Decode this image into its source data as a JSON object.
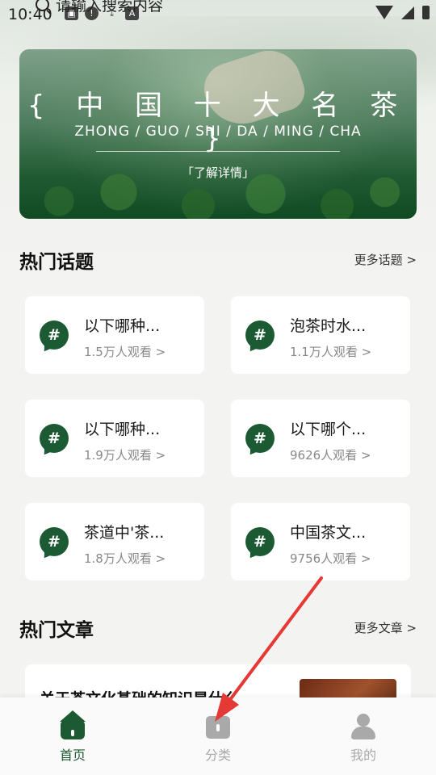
{
  "status_bar": {
    "time": "10:40",
    "icons": [
      "image-icon",
      "alert-icon",
      "download-icon",
      "a-icon"
    ]
  },
  "search": {
    "placeholder": "请输入搜索内容"
  },
  "banner": {
    "title": "{ 中 国 十 大 名 茶 }",
    "pinyin": "ZHONG / GUO / SHI / DA / MING / CHA",
    "more": "「了解详情」"
  },
  "hot_topics": {
    "title": "热门话题",
    "more": "更多话题 >",
    "items": [
      {
        "title": "以下哪种...",
        "views": "1.5万人观看 >"
      },
      {
        "title": "泡茶时水...",
        "views": "1.1万人观看 >"
      },
      {
        "title": "以下哪种...",
        "views": "1.9万人观看 >"
      },
      {
        "title": "以下哪个...",
        "views": "9626人观看 >"
      },
      {
        "title": "茶道中'茶...",
        "views": "1.8万人观看 >"
      },
      {
        "title": "中国茶文...",
        "views": "9756人观看 >"
      }
    ]
  },
  "hot_articles": {
    "title": "热门文章",
    "more": "更多文章 >",
    "items": [
      {
        "title": "关于茶文化基础的知识是什么"
      }
    ]
  },
  "bottom_nav": {
    "items": [
      {
        "label": "首页",
        "active": true,
        "color": "#1c5a33"
      },
      {
        "label": "分类",
        "active": false,
        "color": "#a9a9a9"
      },
      {
        "label": "我的",
        "active": false,
        "color": "#a9a9a9"
      }
    ]
  },
  "colors": {
    "accent": "#1c5a33",
    "annotation": "#e53935"
  }
}
